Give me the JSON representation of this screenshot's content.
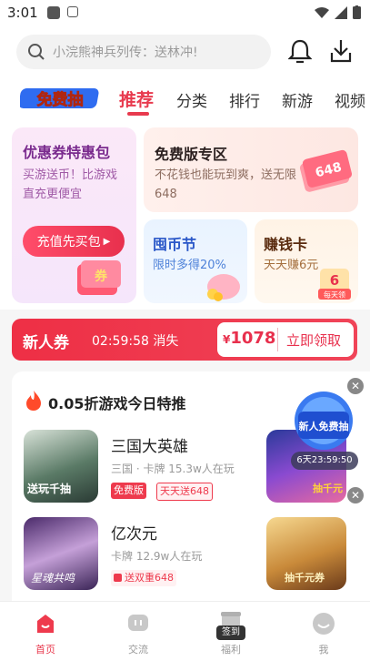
{
  "status": {
    "time": "3:01"
  },
  "search": {
    "placeholder": "小浣熊神兵列传：送林冲!"
  },
  "tabs": [
    {
      "label": "推荐",
      "active": true
    },
    {
      "label": "分类",
      "active": false
    },
    {
      "label": "排行",
      "active": false
    },
    {
      "label": "新游",
      "active": false
    },
    {
      "label": "视频",
      "active": false
    }
  ],
  "logo_text": "免费抽",
  "promo": {
    "coupon_pack": {
      "title": "优惠券特惠包",
      "subtitle": "买游送币！比游戏直充更便宜",
      "button": "充值先买包",
      "decor": "券"
    },
    "free_zone": {
      "title": "免费版专区",
      "subtitle": "不花钱也能玩到爽，送无限648",
      "ticket": "648"
    },
    "coin_fest": {
      "title": "囤币节",
      "subtitle": "限时多得20%"
    },
    "earn_card": {
      "title": "赚钱卡",
      "subtitle": "天天赚6元",
      "badge_num": "6",
      "badge_text": "每天领"
    }
  },
  "newbie_coupon": {
    "label": "新人券",
    "countdown": "02:59:58 消失",
    "currency": "¥",
    "amount": "1078",
    "cta": "立即领取"
  },
  "deals": {
    "title": "0.05折游戏今日特推",
    "games": [
      {
        "name": "三国大英雄",
        "meta": "三国 · 卡牌  15.3w人在玩",
        "tag1": "免费版",
        "tag2": "天天送648",
        "art": "送玩千抽"
      },
      {
        "name": "亿次元",
        "meta": "卡牌  12.9w人在玩",
        "tag1": "送双重648",
        "art": "星魂共鸣"
      }
    ],
    "side_art": [
      "抽千元",
      "抽千元券"
    ]
  },
  "floating_badge": {
    "title": "新人免费抽",
    "timer": "6天23:59:50"
  },
  "bottom_nav": [
    {
      "label": "首页",
      "active": true
    },
    {
      "label": "交流",
      "active": false
    },
    {
      "label": "福利",
      "badge": "签到",
      "active": false
    },
    {
      "label": "我",
      "active": false
    }
  ],
  "colors": {
    "accent": "#e83a4e",
    "coupon_bar": "#ee2f45"
  }
}
